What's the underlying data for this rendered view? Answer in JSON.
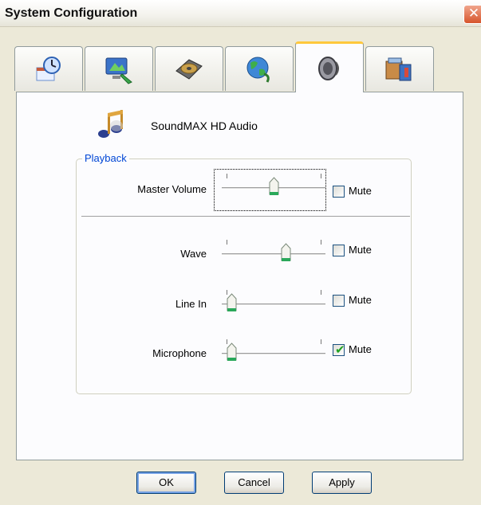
{
  "window": {
    "title": "System Configuration",
    "close_glyph": "✕"
  },
  "tabs": [
    {
      "icon": "clock-calendar-icon",
      "active": false
    },
    {
      "icon": "display-icon",
      "active": false
    },
    {
      "icon": "hard-drive-icon",
      "active": false
    },
    {
      "icon": "network-globe-icon",
      "active": false
    },
    {
      "icon": "speaker-icon",
      "active": true
    },
    {
      "icon": "system-info-icon",
      "active": false
    }
  ],
  "device": {
    "name": "SoundMAX HD Audio",
    "icon": "music-notes-icon"
  },
  "playback": {
    "label": "Playback",
    "master": {
      "label": "Master Volume",
      "level": 0.5,
      "mute_label": "Mute",
      "muted": false
    },
    "channels": [
      {
        "label": "Wave",
        "level": 0.65,
        "mute_label": "Mute",
        "muted": false
      },
      {
        "label": "Line In",
        "level": 0.0,
        "mute_label": "Mute",
        "muted": false
      },
      {
        "label": "Microphone",
        "level": 0.0,
        "mute_label": "Mute",
        "muted": true
      }
    ]
  },
  "buttons": {
    "ok": "OK",
    "cancel": "Cancel",
    "apply": "Apply"
  },
  "colors": {
    "accent": "#ffc83c",
    "group_label": "#0046d5",
    "thumb": "#2aa85a"
  }
}
